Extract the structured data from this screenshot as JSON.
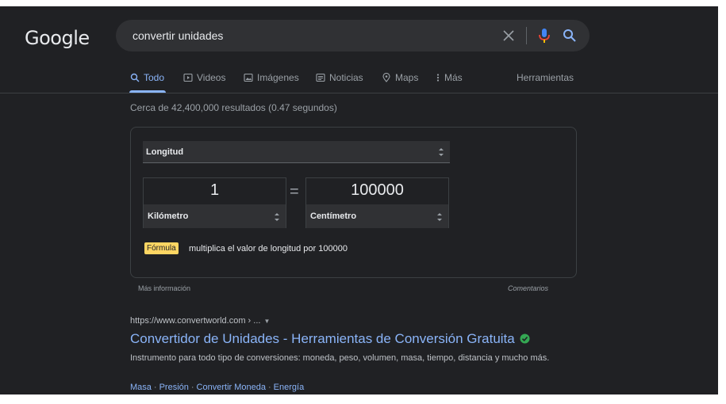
{
  "logo": {
    "text": "Google"
  },
  "search": {
    "query": "convertir unidades",
    "icons": [
      "close-icon",
      "microphone-icon",
      "search-icon"
    ]
  },
  "tabs": [
    {
      "label": "Todo",
      "icon": "search-icon",
      "active": true
    },
    {
      "label": "Videos",
      "icon": "play-icon",
      "active": false
    },
    {
      "label": "Imágenes",
      "icon": "image-icon",
      "active": false
    },
    {
      "label": "Noticias",
      "icon": "news-icon",
      "active": false
    },
    {
      "label": "Maps",
      "icon": "map-pin-icon",
      "active": false
    },
    {
      "label": "Más",
      "icon": "more-vert-icon",
      "active": false
    }
  ],
  "tools_label": "Herramientas",
  "result_stats": "Cerca de 42,400,000 resultados (0.47 segundos)",
  "converter": {
    "unit_type": "Longitud",
    "from_value": "1",
    "from_unit": "Kilómetro",
    "equals": "=",
    "to_value": "100000",
    "to_unit": "Centímetro",
    "formula_label": "Fórmula",
    "formula_text": "multiplica el valor de longitud por 100000"
  },
  "card_footer": {
    "more_info": "Más información",
    "feedback": "Comentarios"
  },
  "result": {
    "url": "https://www.convertworld.com › ...",
    "title": "Convertidor de Unidades - Herramientas de Conversión Gratuita",
    "snippet": "Instrumento para todo tipo de conversiones: moneda, peso, volumen, masa, tiempo, distancia y mucho más.",
    "sitelinks": [
      "Masa",
      "Presión",
      "Convertir Moneda",
      "Energía"
    ]
  },
  "colors": {
    "background": "#202124",
    "search_box": "#303134",
    "link": "#8ab4f8",
    "formula_badge": "#fdd663",
    "verified": "#34a853"
  }
}
